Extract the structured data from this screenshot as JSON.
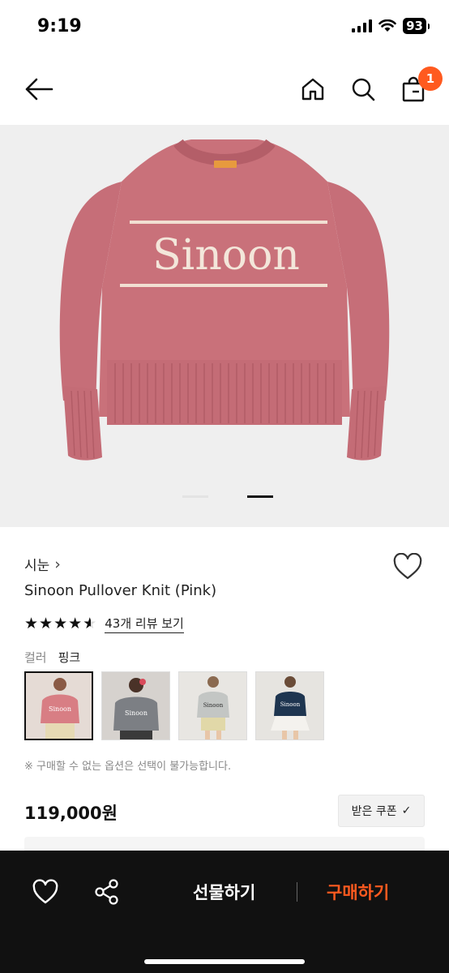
{
  "status": {
    "time": "9:19",
    "battery": "93"
  },
  "nav": {
    "cart_count": "1"
  },
  "product": {
    "image_text": "Sinoon",
    "brand": "시눈",
    "brand_chevron": "›",
    "name": "Sinoon Pullover Knit (Pink)",
    "rating_stars": 4.5,
    "review_link": "43개 리뷰 보기",
    "color_label": "컬러",
    "color_value": "핑크",
    "swatch_names": [
      "pink",
      "gray",
      "light-gray",
      "navy"
    ],
    "notice": "※ 구매할 수 없는 옵션은 선택이 불가능합니다.",
    "price": "119,000원",
    "coupon_label": "받은 쿠폰",
    "coupon_check": "✓"
  },
  "bottom": {
    "gift_label": "선물하기",
    "buy_label": "구매하기"
  },
  "colors": {
    "accent": "#ff5a1f",
    "sweater_pink": "#c9717a",
    "bottom_bar": "#111111"
  }
}
